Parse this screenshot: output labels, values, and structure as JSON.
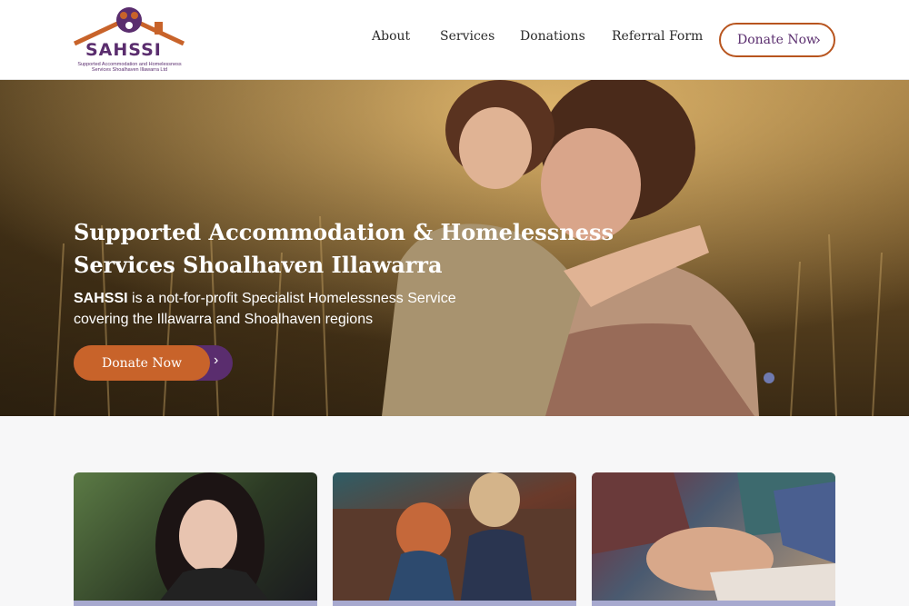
{
  "logo": {
    "name": "SAHSSI",
    "subtitle": "Supported Accommodation and Homelessness Services Shoalhaven Illawarra Ltd",
    "brand_purple": "#5a2d6e",
    "brand_orange": "#c8632a"
  },
  "nav": {
    "items": [
      "About",
      "Services",
      "Donations",
      "Referral Form"
    ],
    "donate_label": "Donate Now"
  },
  "hero": {
    "title_line1": "Supported Accommodation & Homelessness",
    "title_line2": "Services Shoalhaven Illawarra",
    "desc_bold": "SAHSSI",
    "desc_rest": " is a not-for-profit Specialist Homelessness Service covering the Illawarra and Shoalhaven regions",
    "button_label": "Donate Now"
  },
  "cards": [
    {
      "image": "woman-thinking-photo"
    },
    {
      "image": "two-people-comforting-photo"
    },
    {
      "image": "stacked-hands-photo"
    }
  ]
}
